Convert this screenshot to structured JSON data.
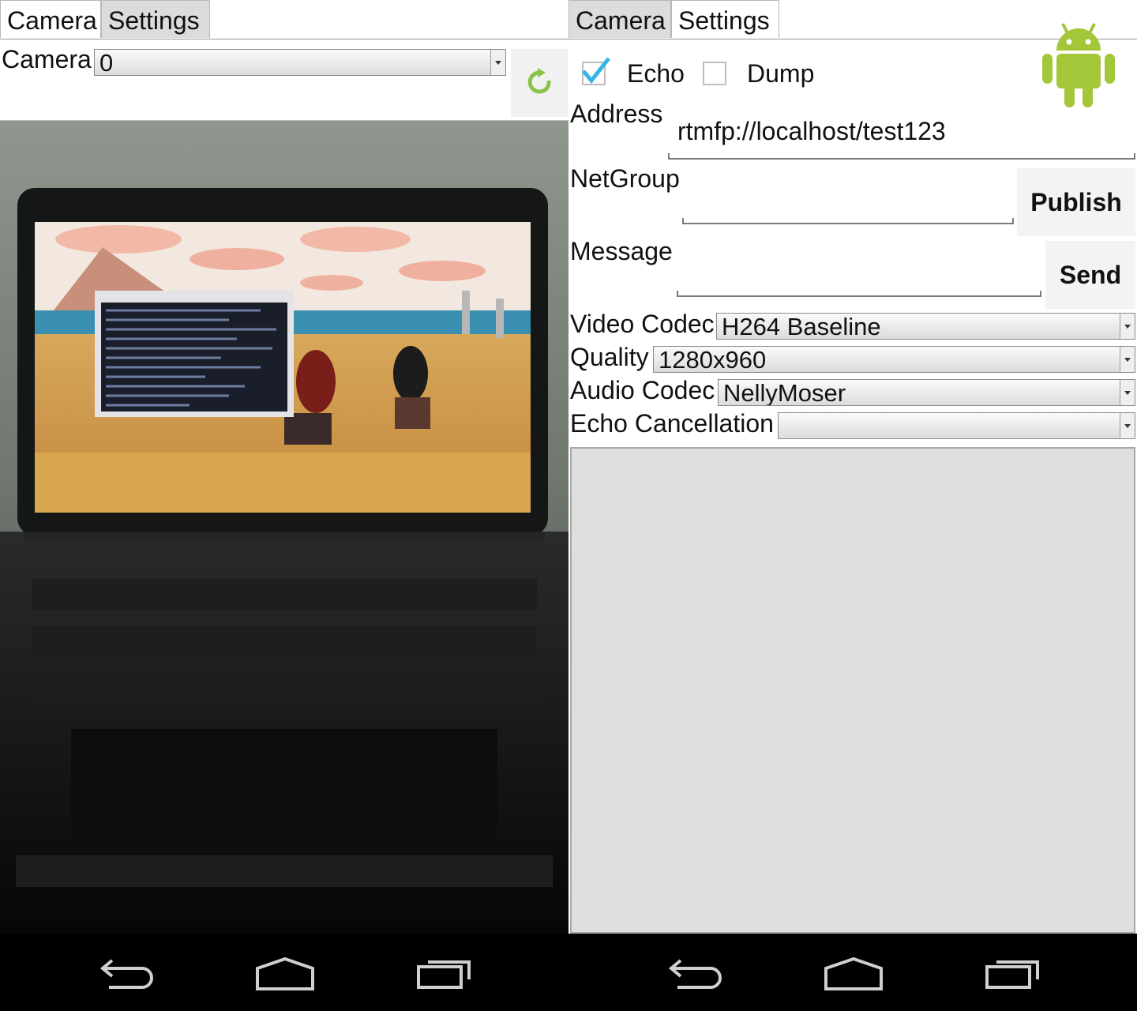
{
  "left_pane": {
    "tabs": [
      {
        "label": "Camera"
      },
      {
        "label": "Settings"
      }
    ],
    "camera_label": "Camera",
    "camera_select_value": "0",
    "refresh_icon": "refresh-icon"
  },
  "right_pane": {
    "tabs": [
      {
        "label": "Camera"
      },
      {
        "label": "Settings"
      }
    ],
    "echo": {
      "label": "Echo",
      "checked": true
    },
    "dump": {
      "label": "Dump",
      "checked": false
    },
    "address_label": "Address",
    "address_value": "rtmfp://localhost/test123",
    "netgroup_label": "NetGroup",
    "netgroup_value": "",
    "publish_label": "Publish",
    "message_label": "Message",
    "message_value": "",
    "send_label": "Send",
    "video_codec_label": "Video Codec",
    "video_codec_value": "H264 Baseline",
    "quality_label": "Quality",
    "quality_value": "1280x960",
    "audio_codec_label": "Audio Codec",
    "audio_codec_value": "NellyMoser",
    "echo_cancellation_label": "Echo Cancellation",
    "echo_cancellation_value": "",
    "logo_icon": "android-logo-icon",
    "colors": {
      "android_green": "#a4c639",
      "check_blue": "#33b5e5"
    }
  },
  "navbar": {
    "icons": [
      "back-icon",
      "home-icon",
      "recent-apps-icon"
    ]
  }
}
